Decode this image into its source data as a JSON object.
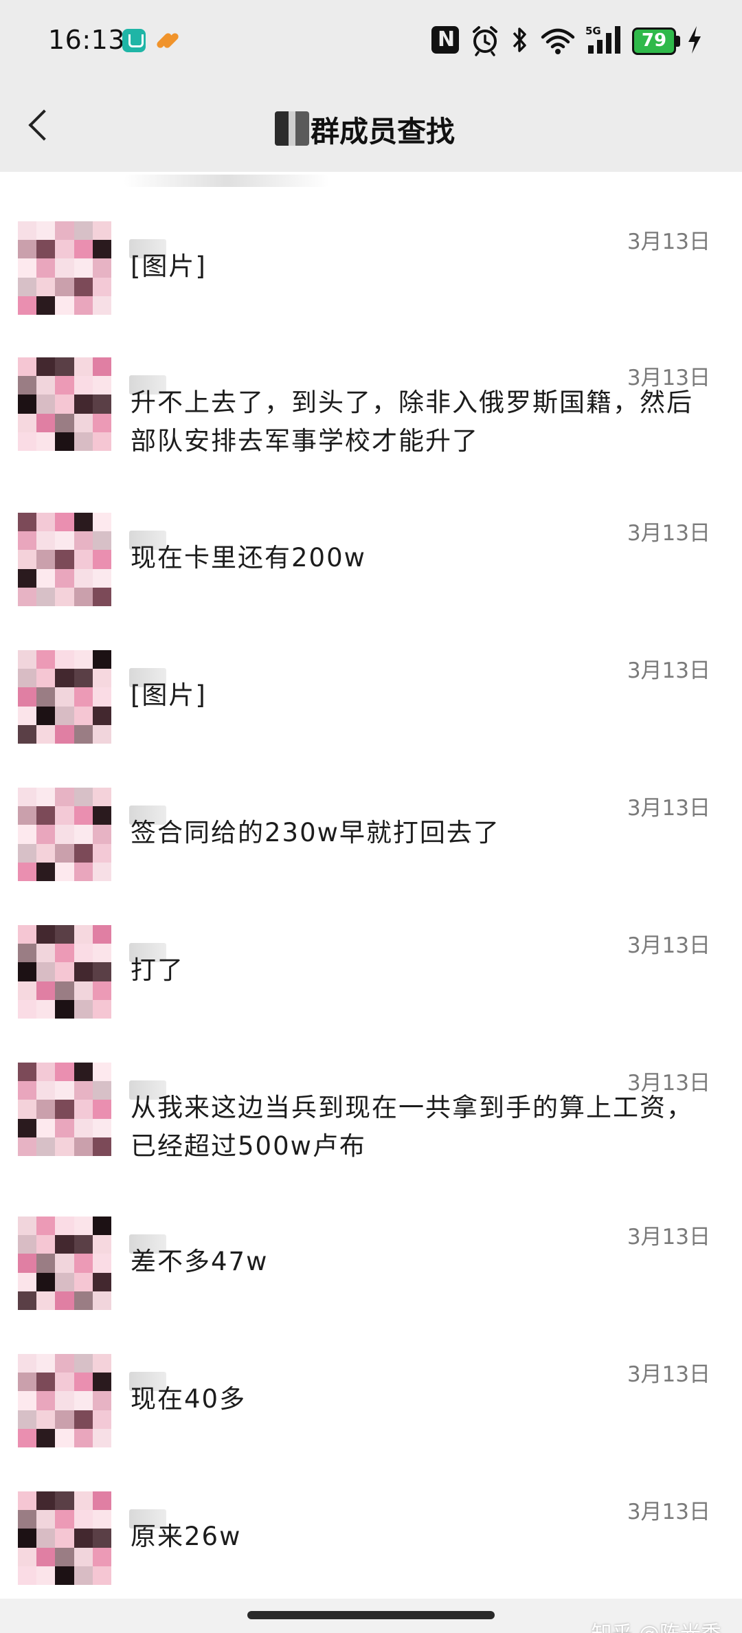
{
  "status_bar": {
    "time": "16:13",
    "battery": "79",
    "signal_label": "5G",
    "icons": [
      "mi-home-icon",
      "taobao-icon",
      "nfc-icon",
      "alarm-icon",
      "bluetooth-icon",
      "wifi-icon",
      "signal-5g-icon",
      "battery-icon",
      "charging-icon"
    ]
  },
  "nav": {
    "title": "群成员查找",
    "back_icon": "chevron-left-icon"
  },
  "messages": [
    {
      "date": "3月13日",
      "text": "[图片]"
    },
    {
      "date": "3月13日",
      "text": "升不上去了，到头了，除非入俄罗斯国籍，然后部队安排去军事学校才能升了"
    },
    {
      "date": "3月13日",
      "text": "现在卡里还有200w"
    },
    {
      "date": "3月13日",
      "text": "[图片]"
    },
    {
      "date": "3月13日",
      "text": "签合同给的230w早就打回去了"
    },
    {
      "date": "3月13日",
      "text": "打了"
    },
    {
      "date": "3月13日",
      "text": "从我来这边当兵到现在一共拿到手的算上工资，已经超过500w卢布"
    },
    {
      "date": "3月13日",
      "text": "差不多47w"
    },
    {
      "date": "3月13日",
      "text": "现在40多"
    },
    {
      "date": "3月13日",
      "text": "原来26w"
    }
  ],
  "watermark": "知乎 @陈光秀",
  "colors": {
    "header_bg": "#ececec",
    "battery_green": "#2fb94a",
    "date_gray": "#7a7a7a",
    "text": "#1c1c1c"
  }
}
